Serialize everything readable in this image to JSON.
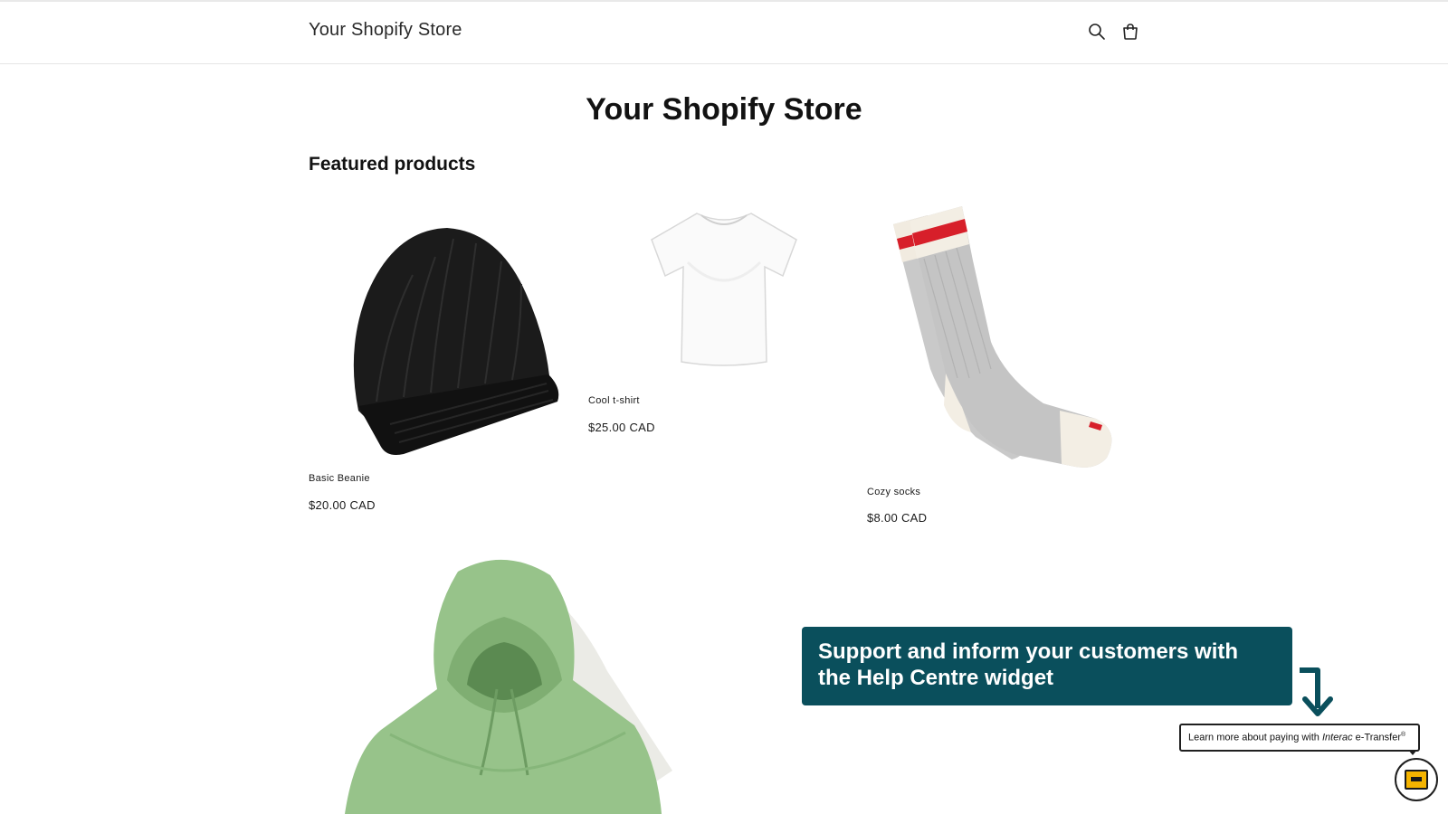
{
  "header": {
    "store_name": "Your Shopify Store",
    "icons": [
      "search-icon",
      "cart-icon"
    ]
  },
  "hero": {
    "title": "Your Shopify Store"
  },
  "featured": {
    "title": "Featured products",
    "products": [
      {
        "name": "Basic Beanie",
        "price": "$20.00 CAD",
        "image": "black-beanie"
      },
      {
        "name": "Cool t-shirt",
        "price": "$25.00 CAD",
        "image": "white-tshirt"
      },
      {
        "name": "Cozy socks",
        "price": "$8.00 CAD",
        "image": "grey-wool-socks"
      },
      {
        "name": "",
        "price": "",
        "image": "green-hoodie"
      }
    ]
  },
  "callout": {
    "text": "Support and inform your customers with the Help Centre widget",
    "color": "#0a4f5c"
  },
  "help_widget": {
    "tooltip_prefix": "Learn more about paying with ",
    "tooltip_brand": "Interac",
    "tooltip_suffix": " e-Transfer",
    "tooltip_mark": "®",
    "accent": "#f5b400"
  }
}
